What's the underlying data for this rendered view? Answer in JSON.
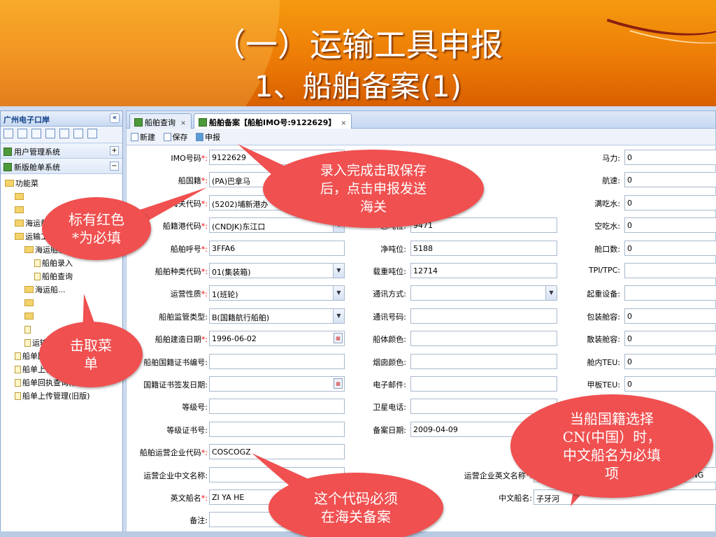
{
  "slide": {
    "title_line1": "（一）运输工具申报",
    "title_line2": "1、船舶备案(1)"
  },
  "left_panel": {
    "title": "广州电子口岸",
    "collapse": "«",
    "toolbar_icons": [
      "table-icon",
      "list-icon",
      "save-icon",
      "home-icon",
      "lock-icon",
      "refresh-icon",
      "up-icon"
    ],
    "panels": [
      {
        "label": "用户管理系统",
        "btn": "+"
      },
      {
        "label": "新版舱单系统",
        "btn": "−"
      }
    ],
    "tree": [
      {
        "label": "功能菜",
        "indent": 0,
        "type": "root"
      },
      {
        "label": "",
        "indent": 1,
        "type": "folder"
      },
      {
        "label": "",
        "indent": 1,
        "type": "folder"
      },
      {
        "label": "海运载报...",
        "indent": 1,
        "type": "folder"
      },
      {
        "label": "运输工具信息",
        "indent": 1,
        "type": "folder"
      },
      {
        "label": "海运船舶备案",
        "indent": 2,
        "type": "folder"
      },
      {
        "label": "船舶录入",
        "indent": 3,
        "type": "file"
      },
      {
        "label": "船舶查询",
        "indent": 3,
        "type": "file"
      },
      {
        "label": "海运船...",
        "indent": 2,
        "type": "folder"
      },
      {
        "label": "",
        "indent": 2,
        "type": "folder"
      },
      {
        "label": "",
        "indent": 2,
        "type": "folder"
      },
      {
        "label": "",
        "indent": 2,
        "type": "file"
      },
      {
        "label": "运输工具回执查询",
        "indent": 2,
        "type": "file"
      },
      {
        "label": "船单回执查询(新版)",
        "indent": 1,
        "type": "file"
      },
      {
        "label": "船单上传管理(新版)",
        "indent": 1,
        "type": "file"
      },
      {
        "label": "船单回执查询(旧版)",
        "indent": 1,
        "type": "file"
      },
      {
        "label": "船单上传管理(旧版)",
        "indent": 1,
        "type": "file"
      }
    ]
  },
  "tabs": [
    {
      "label": "船舶查询",
      "close": "✕"
    },
    {
      "label": "船舶备案【船舶IMO号:9122629】",
      "close": "✕"
    }
  ],
  "toolbar": {
    "new": "新建",
    "save": "保存",
    "submit": "申报"
  },
  "form": {
    "col1": [
      {
        "label": "IMO号码",
        "req": "*:",
        "value": "9122629",
        "kind": "text"
      },
      {
        "label": "船国籍",
        "req": "*:",
        "value": "(PA)巴拿马",
        "kind": "text"
      },
      {
        "label": "海关代码",
        "req": "*:",
        "value": "(5202)埔新港办",
        "kind": "text"
      },
      {
        "label": "船籍港代码",
        "req": "*:",
        "value": "(CNDJK)东江口",
        "kind": "select"
      },
      {
        "label": "船舶呼号",
        "req": "*:",
        "value": "3FFA6",
        "kind": "text"
      },
      {
        "label": "船舶种类代码",
        "req": "*:",
        "value": "01(集装箱)",
        "kind": "select"
      },
      {
        "label": "运营性质",
        "req": "*:",
        "value": "1(班轮)",
        "kind": "select"
      },
      {
        "label": "船舶监管类型",
        "req": ":",
        "value": "B(国籍航行船舶)",
        "kind": "select"
      },
      {
        "label": "船舶建造日期",
        "req": "*:",
        "value": "1996-06-02",
        "kind": "date"
      },
      {
        "label": "船舶国籍证书编号",
        "req": ":",
        "value": "",
        "kind": "text"
      },
      {
        "label": "国籍证书签发日期",
        "req": ":",
        "value": "",
        "kind": "date"
      },
      {
        "label": "等级号",
        "req": ":",
        "value": "",
        "kind": "text"
      },
      {
        "label": "等级证书号",
        "req": ":",
        "value": "",
        "kind": "text"
      },
      {
        "label": "船舶运营企业代码",
        "req": "*:",
        "value": "COSCOGZ",
        "kind": "text"
      },
      {
        "label": "运营企业中文名称",
        "req": ":",
        "value": "",
        "kind": "text"
      },
      {
        "label": "英文船名",
        "req": "*:",
        "value": "ZI YA HE",
        "kind": "text"
      },
      {
        "label": "备注",
        "req": ":",
        "value": "",
        "kind": "text"
      }
    ],
    "col2": [
      {
        "label": "总吨位",
        "req": ":",
        "value": "9471",
        "kind": "text"
      },
      {
        "label": "净吨位",
        "req": ":",
        "value": "5188",
        "kind": "text"
      },
      {
        "label": "载重吨位",
        "req": ":",
        "value": "12714",
        "kind": "text"
      },
      {
        "label": "通讯方式",
        "req": ":",
        "value": "",
        "kind": "select"
      },
      {
        "label": "通讯号码",
        "req": ":",
        "value": "",
        "kind": "text"
      },
      {
        "label": "船体颜色",
        "req": ":",
        "value": "",
        "kind": "text"
      },
      {
        "label": "烟囱颜色",
        "req": ":",
        "value": "",
        "kind": "text"
      },
      {
        "label": "电子邮件",
        "req": ":",
        "value": "",
        "kind": "text"
      },
      {
        "label": "卫星电话",
        "req": ":",
        "value": "",
        "kind": "text"
      },
      {
        "label": "备案日期",
        "req": ":",
        "value": "2009-04-09",
        "kind": "text"
      }
    ],
    "col3": [
      {
        "label": "马力",
        "req": ":",
        "value": "0"
      },
      {
        "label": "航速",
        "req": ":",
        "value": "0"
      },
      {
        "label": "满吃水",
        "req": ":",
        "value": "0"
      },
      {
        "label": "空吃水",
        "req": ":",
        "value": "0"
      },
      {
        "label": "舱口数",
        "req": ":",
        "value": "0"
      },
      {
        "label": "TPI/TPC",
        "req": ":",
        "value": ""
      },
      {
        "label": "起重设备",
        "req": ":",
        "value": ""
      },
      {
        "label": "包装舱容",
        "req": ":",
        "value": "0"
      },
      {
        "label": "散装舱容",
        "req": ":",
        "value": "0"
      },
      {
        "label": "舱内TEU",
        "req": ":",
        "value": "0"
      },
      {
        "label": "甲板TEU",
        "req": ":",
        "value": "0"
      }
    ],
    "en_company": {
      "label": "运营企业英文名称",
      "req": "*:",
      "value": "COSCO GUANGZHOU CONTAINER SHIPPING"
    },
    "cn_ship": {
      "label": "中文船名",
      "req": ":",
      "value": "子牙河"
    }
  },
  "callouts": {
    "required": [
      "标有红色",
      "*为必填"
    ],
    "submit": [
      "录入完成击取保存",
      "后，点击申报发送",
      "海关"
    ],
    "menu": [
      "击取菜",
      "单"
    ],
    "code": [
      "这个代码必须",
      "在海关备案"
    ],
    "nation": [
      "当船国籍选择",
      "CN(中国）时，",
      "中文船名为必填",
      "项"
    ]
  },
  "colors": {
    "accent": "#f05050",
    "banner": "#ed7c06",
    "frame": "#cfdcf0"
  }
}
